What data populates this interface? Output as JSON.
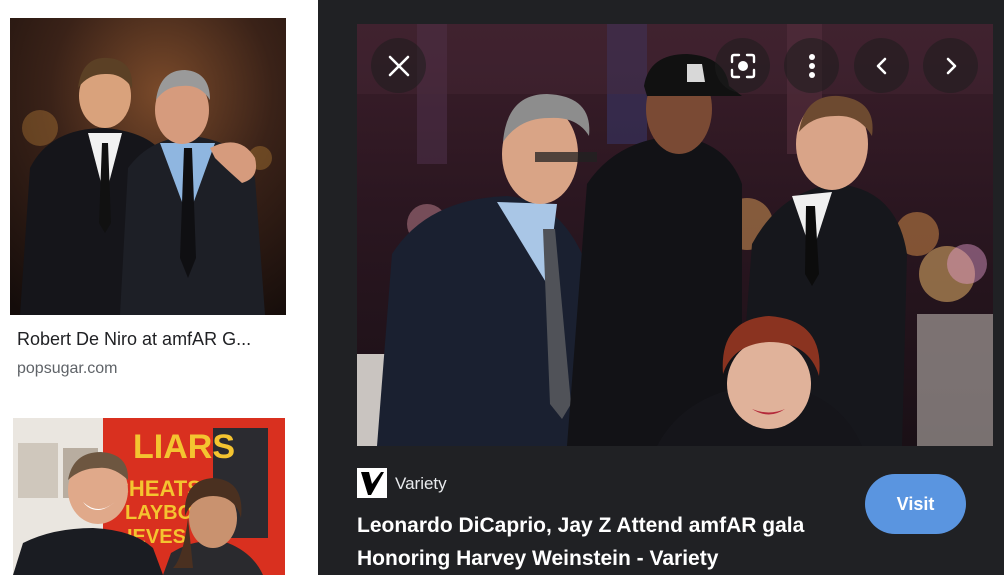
{
  "results": [
    {
      "title": "Robert De Niro at amfAR G...",
      "source": "popsugar.com",
      "image_icon": "photo-thumbnail"
    },
    {
      "poster_text": "LIARS",
      "poster_lines": [
        "CHEATS",
        "LAYBOYS",
        "IEVES"
      ],
      "image_icon": "photo-thumbnail"
    }
  ],
  "preview": {
    "controls": {
      "close_icon": "close-icon",
      "lens_icon": "lens-icon",
      "more_icon": "more-vert-icon",
      "prev_icon": "chevron-left-icon",
      "next_icon": "chevron-right-icon"
    },
    "source_name": "Variety",
    "headline": "Leonardo DiCaprio, Jay Z Attend amfAR gala Honoring Harvey Weinstein - Variety",
    "visit_label": "Visit"
  },
  "colors": {
    "panel_bg": "#202124",
    "visit_button": "#5a95e0",
    "link_text": "#202124",
    "source_text": "#5f6368"
  }
}
